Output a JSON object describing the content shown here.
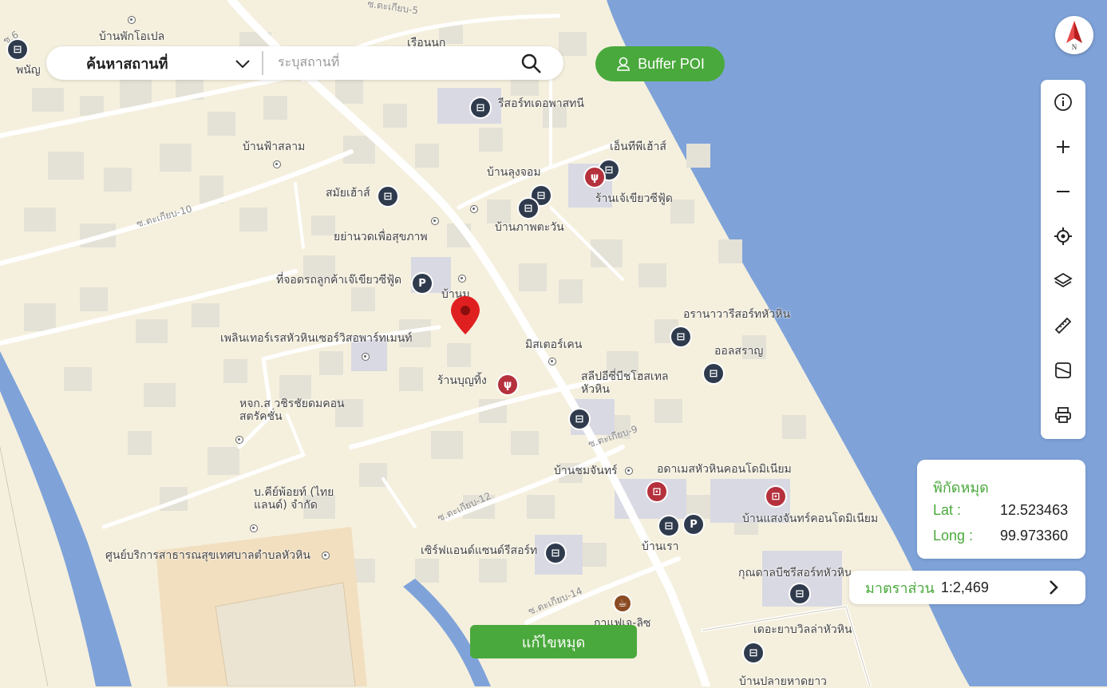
{
  "map": {
    "labels": {
      "ban_phak_oipen": "บ้านพักโอเปล",
      "ruean_nok": "เรือนนก",
      "resort_dao": "รีสอร์ทเดอพาสทนี",
      "ban_fa_sa": "บ้านฟ้าสลาม",
      "nk_house": "เอ็นทีพีเฮ้าส์",
      "ban_lung": "บ้านลุงจอม",
      "samai_house": "สมัยเฮ้าส์",
      "restaurant_je": "ร้านเจ้เขียวซีฟู้ด",
      "ban_pha": "บ้านภาพตะวัน",
      "massage": "ยย่านวดเพื่อสุขภาพ",
      "parking_je": "ที่จอดรถลูกค้าเจ๊เขียวซีฟู้ด",
      "ban_nom": "บ้านม",
      "pleasure": "เพลินเทอร์เรสหัวหินเซอร์วิสอพาร์ทเมนท์",
      "mister": "มิสเตอร์เคน",
      "arana": "อรานาวารีสอร์ทหัวหิน",
      "oolsarn": "ออลสราญ",
      "ran_boon": "ร้านบุญทิ้ง",
      "sleep": "สลีปอีซี่บีชโฮสเทล หัวหิน",
      "hok": "หจก.ส วชิรชัยดมคอนสตรัคชั่น",
      "ban_chom": "บ้านชมจันทร์",
      "adam": "อดาเมสหัวหินคอนโดมิเนียม",
      "bk": "บ.คีย์พ้อยท์ (ไทยแลนด์) จำกัด",
      "ban_saeng": "บ้านแสงจันทร์คอนโดมิเนียม",
      "health": "ศูนย์บริการสาธารณสุขเทศบาลตำบลหัวหิน",
      "serve": "เซิร์ฟแอนด์แซนด์รีสอร์ท",
      "ban_rao": "บ้านเรา",
      "kunda": "กุณดาลบีชรีสอร์ทหัวหิน",
      "cafe": "กาแฟเจ-ลิซ",
      "the_ya": "เดอะยาบวิลล่าหัวหิน",
      "ban_plai": "บ้านปลายหาดยาว",
      "soi10": "ซ.ตะเกียบ-10",
      "soi9": "ซ.ตะเกียบ-9",
      "soi12": "ซ.ตะเกียบ-12",
      "soi14": "ซ.ตะเกียบ-14",
      "soi5": "ซ.ตะเกียบ-5",
      "soi6": "ซ.6",
      "phanu": "พนัญ"
    }
  },
  "search": {
    "type_label": "ค้นหาสถานที่",
    "placeholder": "ระบุสถานที่",
    "value": ""
  },
  "buffer": {
    "label": "Buffer POI"
  },
  "compass": {
    "letter": "N"
  },
  "coords": {
    "title": "พิกัดหมุด",
    "lat_label": "Lat :",
    "lat_value": "12.523463",
    "long_label": "Long :",
    "long_value": "99.973360"
  },
  "scale": {
    "label": "มาตราส่วน",
    "value": "1:2,469"
  },
  "edit_pin": {
    "label": "แก้ไขหมุด"
  },
  "colors": {
    "accent": "#4aa93c",
    "water": "#7fa3d9",
    "pin": "#e02020",
    "land": "#f5f0de"
  }
}
